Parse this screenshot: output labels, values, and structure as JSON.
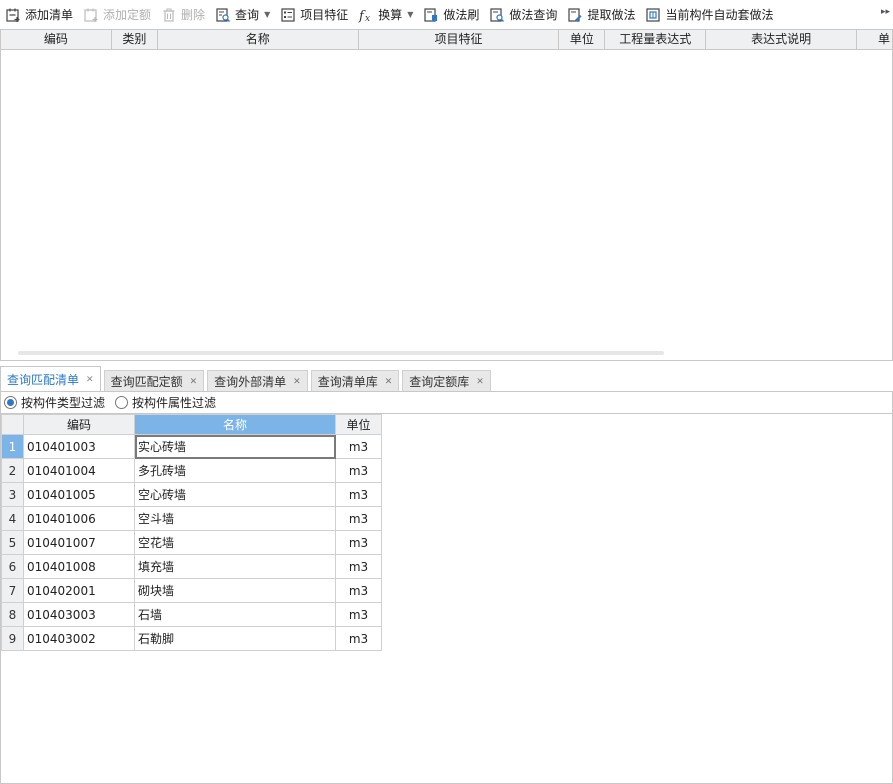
{
  "toolbar": {
    "items": [
      {
        "label": "添加清单",
        "icon": "add-list-icon",
        "disabled": false,
        "caret": false
      },
      {
        "label": "添加定额",
        "icon": "add-quota-icon",
        "disabled": true,
        "caret": false
      },
      {
        "label": "删除",
        "icon": "trash-icon",
        "disabled": true,
        "caret": false
      },
      {
        "label": "查询",
        "icon": "query-icon",
        "disabled": false,
        "caret": true
      },
      {
        "label": "项目特征",
        "icon": "feature-icon",
        "disabled": false,
        "caret": false
      },
      {
        "label": "换算",
        "icon": "fx-icon",
        "disabled": false,
        "caret": true
      },
      {
        "label": "做法刷",
        "icon": "brush-icon",
        "disabled": false,
        "caret": false
      },
      {
        "label": "做法查询",
        "icon": "method-query-icon",
        "disabled": false,
        "caret": false
      },
      {
        "label": "提取做法",
        "icon": "extract-icon",
        "disabled": false,
        "caret": false
      },
      {
        "label": "当前构件自动套做法",
        "icon": "auto-apply-icon",
        "disabled": false,
        "caret": false
      }
    ]
  },
  "upper_grid": {
    "columns": [
      "编码",
      "类别",
      "名称",
      "项目特征",
      "单位",
      "工程量表达式",
      "表达式说明",
      "单"
    ]
  },
  "tabs": [
    {
      "label": "查询匹配清单",
      "active": true
    },
    {
      "label": "查询匹配定额",
      "active": false
    },
    {
      "label": "查询外部清单",
      "active": false
    },
    {
      "label": "查询清单库",
      "active": false
    },
    {
      "label": "查询定额库",
      "active": false
    }
  ],
  "filters": {
    "by_type": "按构件类型过滤",
    "by_attr": "按构件属性过滤"
  },
  "lower_grid": {
    "columns": {
      "code": "编码",
      "name": "名称",
      "unit": "单位"
    },
    "rows": [
      {
        "n": "1",
        "code": "010401003",
        "name": "实心砖墙",
        "unit": "m3"
      },
      {
        "n": "2",
        "code": "010401004",
        "name": "多孔砖墙",
        "unit": "m3"
      },
      {
        "n": "3",
        "code": "010401005",
        "name": "空心砖墙",
        "unit": "m3"
      },
      {
        "n": "4",
        "code": "010401006",
        "name": "空斗墙",
        "unit": "m3"
      },
      {
        "n": "5",
        "code": "010401007",
        "name": "空花墙",
        "unit": "m3"
      },
      {
        "n": "6",
        "code": "010401008",
        "name": "填充墙",
        "unit": "m3"
      },
      {
        "n": "7",
        "code": "010402001",
        "name": "砌块墙",
        "unit": "m3"
      },
      {
        "n": "8",
        "code": "010403003",
        "name": "石墙",
        "unit": "m3"
      },
      {
        "n": "9",
        "code": "010403002",
        "name": "石勒脚",
        "unit": "m3"
      }
    ]
  },
  "colors": {
    "accent": "#2c7ac7",
    "selection": "#7cb4e8",
    "header_bg": "#eef0f2"
  }
}
